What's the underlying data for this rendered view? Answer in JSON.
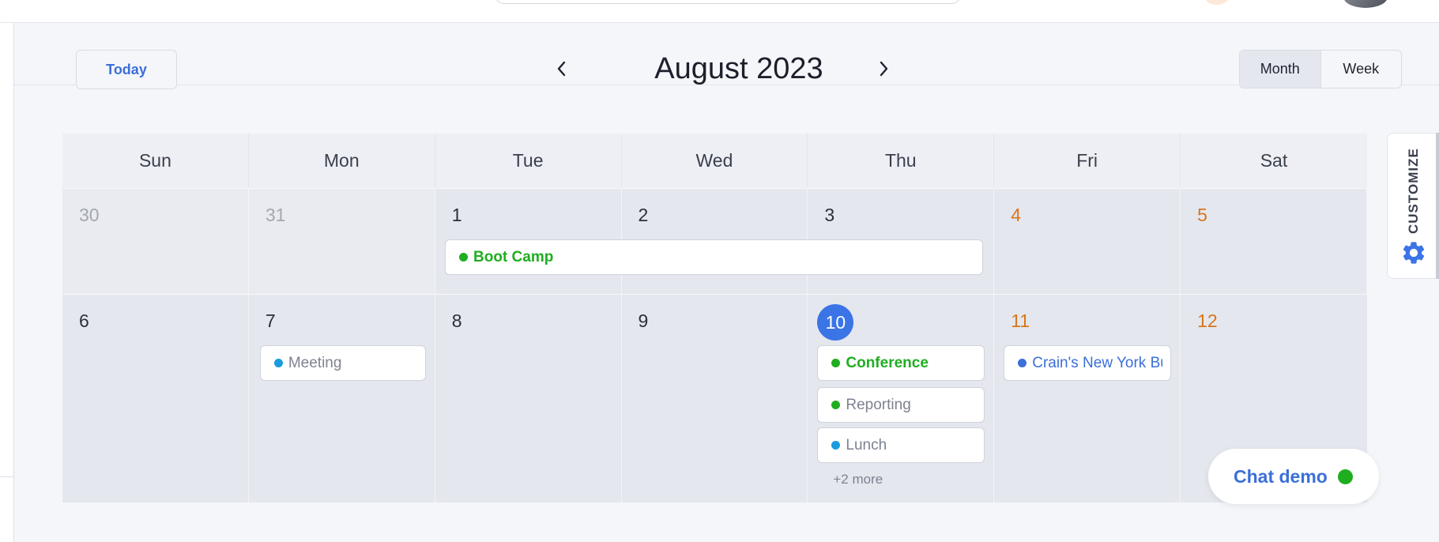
{
  "header": {
    "today_label": "Today",
    "prev_icon": "chevron-left-icon",
    "next_icon": "chevron-right-icon",
    "title": "August 2023",
    "views": [
      {
        "label": "Month",
        "active": true
      },
      {
        "label": "Week",
        "active": false
      }
    ]
  },
  "calendar": {
    "weekdays": [
      "Sun",
      "Mon",
      "Tue",
      "Wed",
      "Thu",
      "Fri",
      "Sat"
    ],
    "week1": [
      "30",
      "31",
      "1",
      "2",
      "3",
      "4",
      "5"
    ],
    "week2": [
      "6",
      "7",
      "8",
      "9",
      "10",
      "11",
      "12"
    ],
    "today": "10",
    "events": {
      "boot_camp": {
        "label": "Boot Camp",
        "color": "#1fae1f"
      },
      "meeting": {
        "label": "Meeting",
        "color": "#1a9be0"
      },
      "conference": {
        "label": "Conference",
        "color": "#1fae1f"
      },
      "reporting": {
        "label": "Reporting",
        "color": "#1fae1f"
      },
      "lunch": {
        "label": "Lunch",
        "color": "#1a9be0"
      },
      "crains": {
        "label": "Crain's New York Business",
        "color": "#3b6fd9"
      }
    },
    "more_label": "+2 more"
  },
  "customize": {
    "label": "CUSTOMIZE",
    "icon": "gear-icon"
  },
  "chat": {
    "label": "Chat demo",
    "status_color": "#1fae1f"
  },
  "colors": {
    "accent": "#3b74e6",
    "weekend_date": "#d8751a",
    "event_muted_text": "#7d8290"
  }
}
